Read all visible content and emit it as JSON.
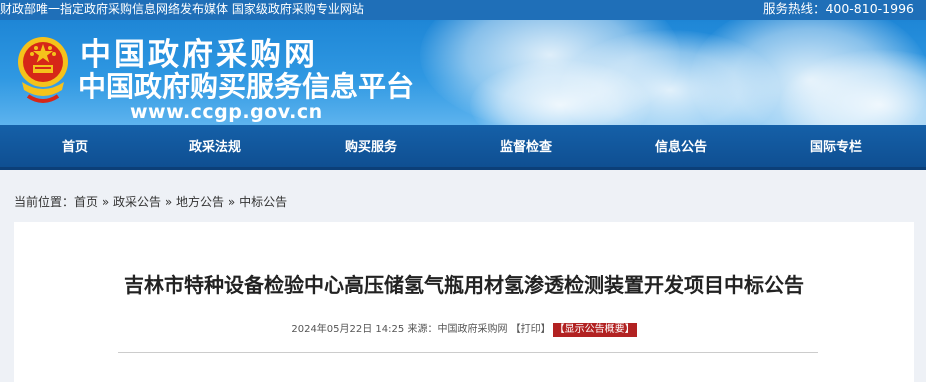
{
  "topbar": {
    "left_text": "财政部唯一指定政府采购信息网络发布媒体  国家级政府采购专业网站",
    "hotline": "服务热线：400-810-1996"
  },
  "header": {
    "site_title": "中国政府采购网",
    "site_subtitle": "中国政府购买服务信息平台",
    "site_url": "www.ccgp.gov.cn"
  },
  "nav": {
    "items": [
      {
        "label": "首页"
      },
      {
        "label": "政采法规"
      },
      {
        "label": "购买服务"
      },
      {
        "label": "监督检查"
      },
      {
        "label": "信息公告"
      },
      {
        "label": "国际专栏"
      }
    ]
  },
  "breadcrumb": {
    "prefix": "当前位置：",
    "home": "首页",
    "sep": "»",
    "level1": "政采公告",
    "level2": "地方公告",
    "level3": "中标公告"
  },
  "notice": {
    "title": "吉林市特种设备检验中心高压储氢气瓶用材氢渗透检测装置开发项目中标公告",
    "datetime": "2024年05月22日 14:25",
    "source_label": "来源：",
    "source": "中国政府采购网",
    "print": "【打印】",
    "summary_button": "【显示公告概要】"
  }
}
